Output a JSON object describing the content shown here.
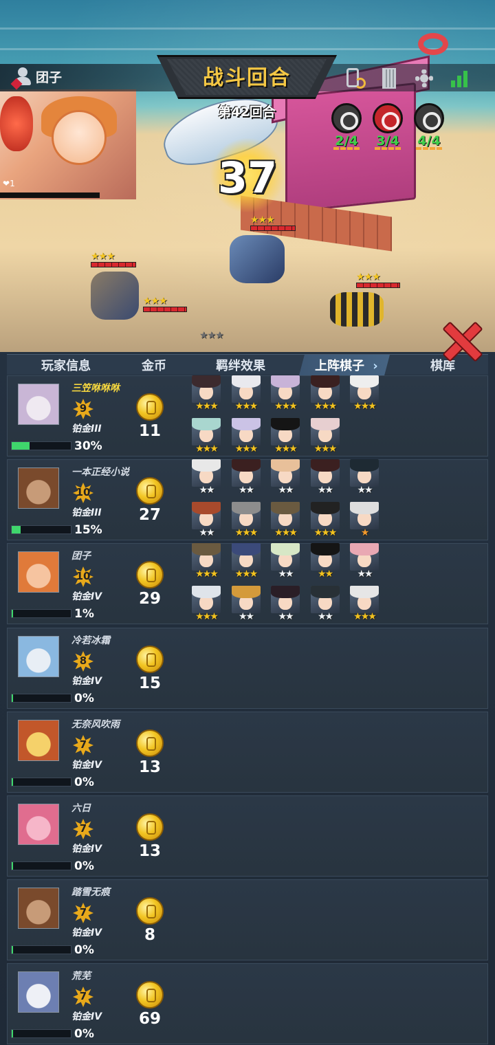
{
  "header": {
    "player_name": "团子",
    "title": "战斗回合",
    "round": "第42回合",
    "countdown": "37",
    "avatar_hearts": "❤",
    "avatar_hp": "1"
  },
  "icons": {
    "user": "user-icon",
    "phone_sync": "phone-sync-icon",
    "book": "book-icon",
    "settings": "gear-icon",
    "signal": "signal-icon",
    "close": "close-icon"
  },
  "synergies": [
    {
      "count": "2/4",
      "color": "#3a3a3a",
      "name": "swirl-emblem-icon"
    },
    {
      "count": "3/4",
      "color": "#c4262a",
      "name": "spiral-emblem-icon"
    },
    {
      "count": "4/4",
      "color": "#3a3a3a",
      "name": "cross-emblem-icon"
    }
  ],
  "tabs": {
    "player_info": "玩家信息",
    "gold": "金币",
    "bond": "羁绊效果",
    "deployed": "上阵棋子",
    "bench": "棋库",
    "arrow": "›"
  },
  "colors": {
    "accent": "#f4c744",
    "xp": "#3fd66c",
    "star_gold": "#f2c21f",
    "star_white": "#eef2f6",
    "star_orange": "#f39a2c",
    "name_highlight": "#f6d73f"
  },
  "players": [
    {
      "name": "三笠咻咻咻",
      "level": "9",
      "rank": "铂金III",
      "xp": "30%",
      "xp_fraction": 0.3,
      "gold": "11",
      "highlight": true,
      "portrait": [
        "#efe9f1",
        "#c9b6d6"
      ],
      "pieces": [
        {
          "stars": "★★★",
          "star_color": "gold",
          "hair": "#3c2a2e"
        },
        {
          "stars": "★★★",
          "star_color": "gold",
          "hair": "#e9e9ee"
        },
        {
          "stars": "★★★",
          "star_color": "gold",
          "hair": "#c8b3d8"
        },
        {
          "stars": "★★★",
          "star_color": "gold",
          "hair": "#3a2020"
        },
        {
          "stars": "★★★",
          "star_color": "gold",
          "hair": "#eeeeee"
        },
        {
          "stars": "★★★",
          "star_color": "gold",
          "hair": "#a9d6cf"
        },
        {
          "stars": "★★★",
          "star_color": "gold",
          "hair": "#cbc3e6"
        },
        {
          "stars": "★★★",
          "star_color": "gold",
          "hair": "#151515"
        },
        {
          "stars": "★★★",
          "star_color": "gold",
          "hair": "#e7cfd0"
        }
      ]
    },
    {
      "name": "一本正经小说",
      "level": "10",
      "rank": "铂金III",
      "xp": "15%",
      "xp_fraction": 0.15,
      "gold": "27",
      "highlight": false,
      "portrait": [
        "#c79b78",
        "#7a4a2c"
      ],
      "pieces": [
        {
          "stars": "★★",
          "star_color": "white",
          "hair": "#e8e8e8"
        },
        {
          "stars": "★★",
          "star_color": "white",
          "hair": "#3b2020"
        },
        {
          "stars": "★★",
          "star_color": "white",
          "hair": "#e8c09a"
        },
        {
          "stars": "★★",
          "star_color": "white",
          "hair": "#3b2020"
        },
        {
          "stars": "★★",
          "star_color": "white",
          "hair": "#1e2a33"
        },
        {
          "stars": "★★",
          "star_color": "white",
          "hair": "#a84a2c"
        },
        {
          "stars": "★★★",
          "star_color": "gold",
          "hair": "#8d8d8d"
        },
        {
          "stars": "★★★",
          "star_color": "gold",
          "hair": "#6a5a40"
        },
        {
          "stars": "★★★",
          "star_color": "gold",
          "hair": "#222222"
        },
        {
          "stars": "★",
          "star_color": "orange",
          "hair": "#dedede"
        }
      ]
    },
    {
      "name": "团子",
      "level": "10",
      "rank": "铂金IV",
      "xp": "1%",
      "xp_fraction": 0.01,
      "gold": "29",
      "highlight": false,
      "portrait": [
        "#f6c4a0",
        "#e07a3a"
      ],
      "pieces": [
        {
          "stars": "★★★",
          "star_color": "gold",
          "hair": "#6a5a40"
        },
        {
          "stars": "★★★",
          "star_color": "gold",
          "hair": "#3b4a7a"
        },
        {
          "stars": "★★",
          "star_color": "white",
          "hair": "#d7e7c6"
        },
        {
          "stars": "★★",
          "star_color": "gold",
          "hair": "#151515"
        },
        {
          "stars": "★★",
          "star_color": "white",
          "hair": "#e9a8b3"
        },
        {
          "stars": "★★★",
          "star_color": "gold",
          "hair": "#dfe4ea"
        },
        {
          "stars": "★★",
          "star_color": "white",
          "hair": "#d49a3b"
        },
        {
          "stars": "★★",
          "star_color": "white",
          "hair": "#2a1e26"
        },
        {
          "stars": "★★",
          "star_color": "white",
          "hair": "#283036"
        },
        {
          "stars": "★★★",
          "star_color": "gold",
          "hair": "#e6e6e6"
        }
      ]
    },
    {
      "name": "冷若冰霜",
      "level": "8",
      "rank": "铂金IV",
      "xp": "0%",
      "xp_fraction": 0.0,
      "gold": "15",
      "highlight": false,
      "portrait": [
        "#e8eef5",
        "#8ab8e0"
      ],
      "pieces": []
    },
    {
      "name": "无奈风吹雨",
      "level": "7",
      "rank": "铂金IV",
      "xp": "0%",
      "xp_fraction": 0.0,
      "gold": "13",
      "highlight": false,
      "portrait": [
        "#f5d16a",
        "#c2572a"
      ],
      "pieces": []
    },
    {
      "name": "六日",
      "level": "7",
      "rank": "铂金IV",
      "xp": "0%",
      "xp_fraction": 0.0,
      "gold": "13",
      "highlight": false,
      "portrait": [
        "#f6b6c9",
        "#e06d8f"
      ],
      "pieces": []
    },
    {
      "name": "踏雪无痕",
      "level": "7",
      "rank": "铂金IV",
      "xp": "0%",
      "xp_fraction": 0.0,
      "gold": "8",
      "highlight": false,
      "portrait": [
        "#c79b78",
        "#7a4a2c"
      ],
      "pieces": []
    },
    {
      "name": "荒芜",
      "level": "7",
      "rank": "铂金IV",
      "xp": "0%",
      "xp_fraction": 0.0,
      "gold": "69",
      "highlight": false,
      "portrait": [
        "#eef0f6",
        "#6d7fb2"
      ],
      "pieces": []
    }
  ]
}
